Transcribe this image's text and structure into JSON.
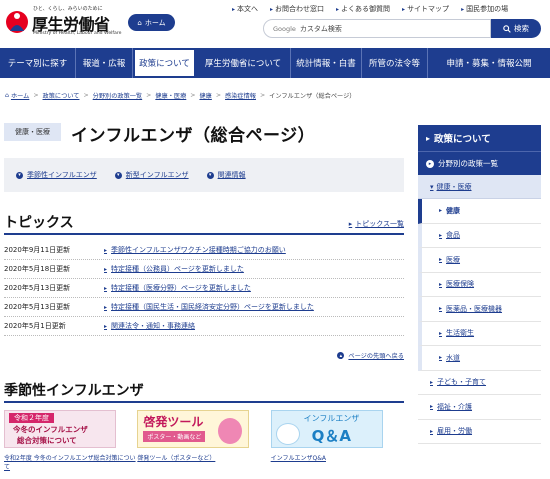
{
  "header": {
    "logo_tagline": "ひと、くらし、みらいのために",
    "logo_name": "厚生労働省",
    "logo_en": "Ministry of Health, Labour and Welfare",
    "home_label": "ホーム",
    "util_links": [
      "本文へ",
      "お問合わせ窓口",
      "よくある御質問",
      "サイトマップ",
      "国民参加の場"
    ],
    "search_brand": "Google",
    "search_placeholder": "カスタム検索",
    "search_button": "検索"
  },
  "gnav": [
    {
      "label": "テーマ別に探す",
      "width": 76
    },
    {
      "label": "報道・広報",
      "width": 57
    },
    {
      "label": "政策について",
      "width": 63
    },
    {
      "label": "厚生労働省について",
      "width": 95
    },
    {
      "label": "統計情報・白書",
      "width": 71
    },
    {
      "label": "所管の法令等",
      "width": 66
    },
    {
      "label": "申請・募集・情報公開",
      "width": 122
    }
  ],
  "breadcrumb": {
    "items": [
      "ホーム",
      "政策について",
      "分野別の政策一覧",
      "健康・医療",
      "健康",
      "感染症情報"
    ],
    "current": "インフルエンザ（総合ページ）"
  },
  "main": {
    "category": "健康・医療",
    "title": "インフルエンザ（総合ページ）",
    "anchors": [
      "季節性インフルエンザ",
      "新型インフルエンザ",
      "関連情報"
    ],
    "topics_title": "トピックス",
    "topics_more": "トピックス一覧",
    "topics": [
      {
        "date": "2020年9月11日更新",
        "text": "季節性インフルエンザワクチン接種時期ご協力のお願い"
      },
      {
        "date": "2020年5月18日更新",
        "text": "特定接種（公務員）ページを更新しました"
      },
      {
        "date": "2020年5月13日更新",
        "text": "特定接種（医療分野）ページを更新しました"
      },
      {
        "date": "2020年5月13日更新",
        "text": "特定接種（国民生活・国民経済安定分野）ページを更新しました"
      },
      {
        "date": "2020年5月1日更新",
        "text": "関連法令・通知・事務連絡"
      }
    ],
    "back_to_top": "ページの先頭へ戻る",
    "seasonal_title": "季節性インフルエンザ",
    "banners": [
      {
        "tag": "令和２年度",
        "line1": "今冬のインフルエンザ",
        "line2": "総合対策について",
        "caption": "令和2年度 今冬のインフルエンザ総合対策について"
      },
      {
        "line1": "啓発ツール",
        "line2": "ポスター・動画など",
        "caption": "啓発ツール（ポスターなど）"
      },
      {
        "line1": "インフルエンザ",
        "line2": "Q＆A",
        "caption": "インフルエンザQ&A"
      }
    ]
  },
  "side": {
    "title": "政策について",
    "sub": "分野別の政策一覧",
    "group": "健康・医療",
    "items": [
      "健康",
      "食品",
      "医療",
      "医療保険",
      "医薬品・医療機器",
      "生活衛生",
      "水道"
    ],
    "current_index": 0,
    "groups_after": [
      "子ども・子育て",
      "福祉・介護",
      "雇用・労働"
    ]
  }
}
